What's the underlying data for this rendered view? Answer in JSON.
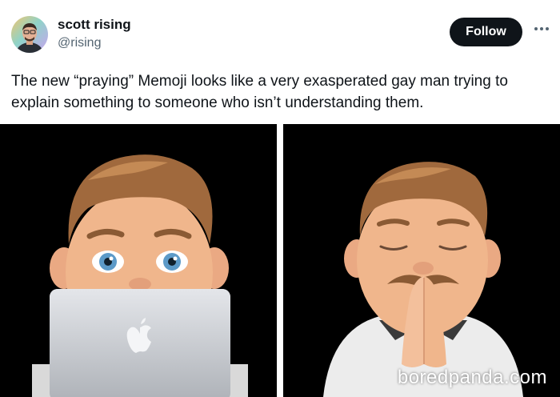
{
  "author": {
    "display_name": "scott rising",
    "handle": "@rising"
  },
  "actions": {
    "follow_label": "Follow",
    "more_icon": "more-horizontal-icon"
  },
  "tweet": {
    "text": "The new “praying” Memoji looks like a very exasperated gay man trying to explain something to someone who isn’t understanding them."
  },
  "media": [
    {
      "description_icon": "memoji-laptop-image"
    },
    {
      "description_icon": "memoji-praying-image"
    }
  ],
  "watermark": "boredpanda.com",
  "colors": {
    "follow_bg": "#0f1419",
    "handle": "#536471",
    "hair": "#a0693d",
    "skin": "#f0b68c"
  }
}
